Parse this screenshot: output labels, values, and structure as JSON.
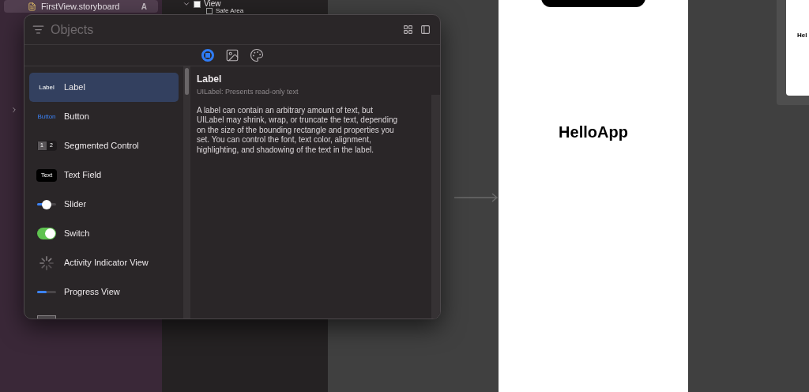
{
  "navigator": {
    "file": {
      "name": "FirstView.storyboard",
      "badge": "A",
      "selected": true
    },
    "group": {
      "expanded": false
    }
  },
  "outline": {
    "items": [
      {
        "label": "View",
        "expanded": true,
        "children": [
          {
            "label": "Safe Area"
          }
        ]
      }
    ]
  },
  "objects_panel": {
    "search": {
      "placeholder": "Objects"
    },
    "tabs": [
      {
        "kind": "objects",
        "selected": true
      },
      {
        "kind": "media",
        "selected": false
      },
      {
        "kind": "colors",
        "selected": false
      }
    ],
    "items": [
      {
        "kind": "label",
        "preview": "Label",
        "name": "Label",
        "selected": true
      },
      {
        "kind": "button",
        "preview": "Button",
        "name": "Button",
        "selected": false
      },
      {
        "kind": "segmented",
        "segments": [
          "1",
          "2"
        ],
        "name": "Segmented Control",
        "selected": false
      },
      {
        "kind": "textfield",
        "preview": "Text",
        "name": "Text Field",
        "selected": false
      },
      {
        "kind": "slider",
        "level": 0.5,
        "name": "Slider",
        "selected": false
      },
      {
        "kind": "switch",
        "on": true,
        "name": "Switch",
        "selected": false
      },
      {
        "kind": "activity",
        "name": "Activity Indicator View",
        "selected": false
      },
      {
        "kind": "progress",
        "level": 0.5,
        "name": "Progress View",
        "selected": false
      },
      {
        "kind": "view"
      }
    ],
    "detail": {
      "title": "Label",
      "subtitle": "UILabel: Presents read-only text",
      "description": "A label can contain an arbitrary amount of text, but UILabel may shrink, wrap, or truncate the text, depending on the size of the bounding rectangle and properties you set. You can control the font, text color, alignment, highlighting, and shadowing of the text in the label."
    }
  },
  "canvas": {
    "scene": {
      "title": "HelloApp"
    },
    "preview": {
      "title": "Hel"
    }
  }
}
